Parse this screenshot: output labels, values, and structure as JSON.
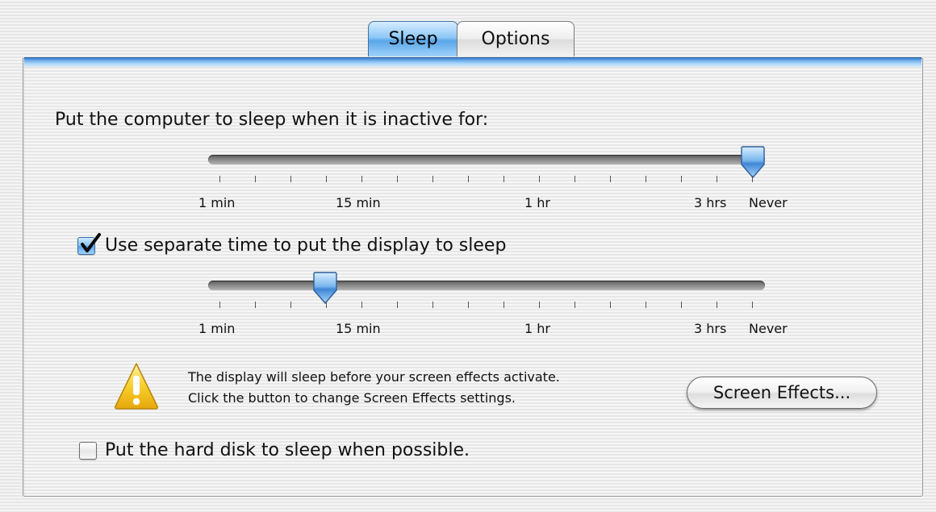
{
  "tabs": [
    {
      "label": "Sleep",
      "selected": true
    },
    {
      "label": "Options",
      "selected": false
    }
  ],
  "computer_sleep": {
    "label": "Put the computer to sleep when it is inactive for:",
    "setting": "Never",
    "tick_labels": [
      "1 min",
      "15 min",
      "1 hr",
      "3 hrs",
      "Never"
    ]
  },
  "display_sleep": {
    "checkbox_label": "Use separate time to put the display to sleep",
    "checked": true,
    "setting": "15 min",
    "tick_labels": [
      "1 min",
      "15 min",
      "1 hr",
      "3 hrs",
      "Never"
    ]
  },
  "warning": {
    "icon": "warning-triangle-icon",
    "line1": "The display will sleep before your screen effects activate.",
    "line2": "Click the button to change Screen Effects settings."
  },
  "screen_effects_button": {
    "label": "Screen Effects..."
  },
  "hard_disk": {
    "label": "Put the hard disk to sleep when possible.",
    "checked": false
  },
  "colors": {
    "accent": "#5aa6e8",
    "warning": "#f6c21a"
  }
}
